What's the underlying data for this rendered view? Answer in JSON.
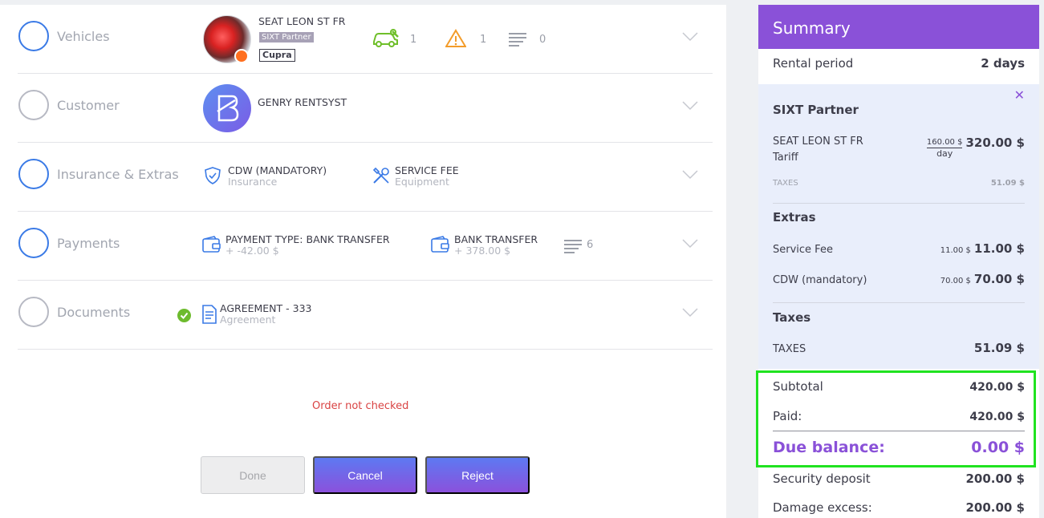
{
  "sections": {
    "vehicles": {
      "title": "Vehicles",
      "car_name": "SEAT LEON ST FR",
      "partner_tag": "SIXT Partner",
      "brand_tag": "Cupra",
      "maintenance_count": "1",
      "warning_count": "1",
      "notes_count": "0"
    },
    "customer": {
      "title": "Customer",
      "name": "GENRY RENTSYST"
    },
    "insurance": {
      "title": "Insurance & Extras",
      "item1_title": "CDW (MANDATORY)",
      "item1_sub": "Insurance",
      "item2_title": "SERVICE FEE",
      "item2_sub": "Equipment"
    },
    "payments": {
      "title": "Payments",
      "item1_title": "PAYMENT TYPE: BANK TRANSFER",
      "item1_sub": "+ -42.00 $",
      "item2_title": "BANK TRANSFER",
      "item2_sub": "+ 378.00 $",
      "notes_count": "6"
    },
    "documents": {
      "title": "Documents",
      "item_title": "AGREEMENT - 333",
      "item_sub": "Agreement"
    }
  },
  "status_text": "Order not checked",
  "buttons": {
    "done": "Done",
    "cancel": "Cancel",
    "reject": "Reject"
  },
  "summary": {
    "title": "Summary",
    "rental_period_label": "Rental period",
    "rental_period_value": "2 days",
    "partner_title": "SIXT Partner",
    "car_line1": "SEAT LEON ST FR",
    "car_line2": "Tariff",
    "car_unit_price": "160.00 $",
    "car_unit": "day",
    "car_total": "320.00 $",
    "taxes_small_label": "TAXES",
    "taxes_small_value": "51.09 $",
    "extras_title": "Extras",
    "extras": [
      {
        "label": "Service Fee",
        "unit": "11.00 $",
        "total": "11.00 $"
      },
      {
        "label": "CDW (mandatory)",
        "unit": "70.00 $",
        "total": "70.00 $"
      }
    ],
    "taxes_title": "Taxes",
    "taxes_label": "TAXES",
    "taxes_value": "51.09 $",
    "subtotal_label": "Subtotal",
    "subtotal_value": "420.00 $",
    "paid_label": "Paid:",
    "paid_value": "420.00 $",
    "due_label": "Due balance:",
    "due_value": "0.00 $",
    "deposit_label": "Security deposit",
    "deposit_value": "200.00 $",
    "damage_label": "Damage excess:",
    "damage_value": "200.00 $"
  },
  "colors": {
    "accent": "#8a51d8",
    "active_circle": "#3a7ae6",
    "status_error": "#d94343",
    "highlight": "#20e320"
  }
}
